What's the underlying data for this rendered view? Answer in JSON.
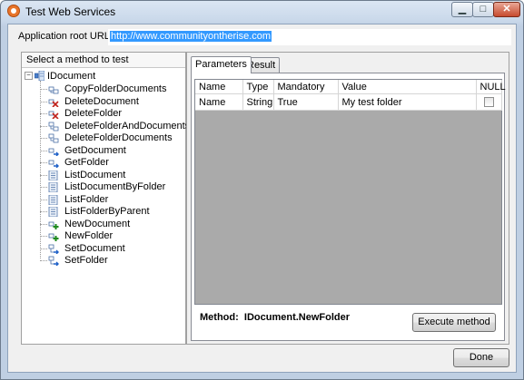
{
  "window": {
    "title": "Test Web Services",
    "minimize": "▁",
    "maximize": "□",
    "close": "✕"
  },
  "url": {
    "label": "Application root URL:",
    "value": "http://www.communityontherise.com",
    "arrow": "▼"
  },
  "methods": {
    "header": "Select a method to test",
    "root": "IDocument",
    "items": [
      {
        "label": "CopyFolderDocuments",
        "icon": "copy-icon"
      },
      {
        "label": "DeleteDocument",
        "icon": "delete-icon"
      },
      {
        "label": "DeleteFolder",
        "icon": "delete-icon"
      },
      {
        "label": "DeleteFolderAndDocuments",
        "icon": "delete-multi-icon"
      },
      {
        "label": "DeleteFolderDocuments",
        "icon": "delete-multi-icon"
      },
      {
        "label": "GetDocument",
        "icon": "get-icon"
      },
      {
        "label": "GetFolder",
        "icon": "get-icon"
      },
      {
        "label": "ListDocument",
        "icon": "list-icon"
      },
      {
        "label": "ListDocumentByFolder",
        "icon": "list-icon"
      },
      {
        "label": "ListFolder",
        "icon": "list-icon"
      },
      {
        "label": "ListFolderByParent",
        "icon": "list-icon"
      },
      {
        "label": "NewDocument",
        "icon": "new-icon"
      },
      {
        "label": "NewFolder",
        "icon": "new-icon"
      },
      {
        "label": "SetDocument",
        "icon": "set-icon"
      },
      {
        "label": "SetFolder",
        "icon": "set-icon"
      }
    ]
  },
  "tabs": [
    {
      "label": "Parameters",
      "active": true
    },
    {
      "label": "Result",
      "active": false
    }
  ],
  "params": {
    "columns": [
      "Name",
      "Type",
      "Mandatory",
      "Value",
      "NULL"
    ],
    "rows": [
      {
        "name": "Name",
        "type": "String",
        "mandatory": "True",
        "value": "My test folder",
        "null": false
      }
    ]
  },
  "method": {
    "label": "Method:",
    "value": "IDocument.NewFolder"
  },
  "buttons": {
    "execute": "Execute method",
    "done": "Done"
  }
}
